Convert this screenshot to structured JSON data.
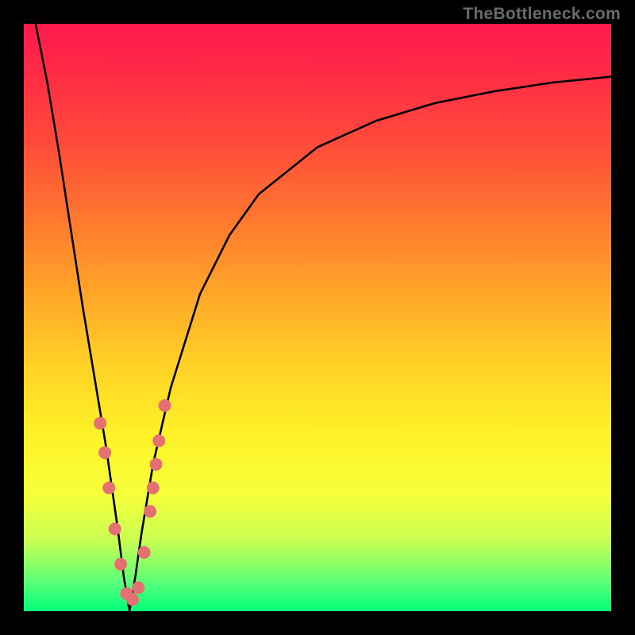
{
  "watermark": {
    "text": "TheBottleneck.com"
  },
  "colors": {
    "frame": "#000000",
    "curve": "#000000",
    "markers": "#e47072",
    "gradient_stops": [
      "#ff1a4d",
      "#ff2a46",
      "#ff4a3a",
      "#ff7a2e",
      "#ffa628",
      "#ffd126",
      "#fff228",
      "#f7ff3a",
      "#c9ff52",
      "#5cff78",
      "#00ff7a"
    ]
  },
  "chart_data": {
    "type": "line",
    "title": "",
    "xlabel": "",
    "ylabel": "",
    "xlim": [
      0,
      100
    ],
    "ylim": [
      0,
      100
    ],
    "notch_x": 18,
    "series": [
      {
        "name": "bottleneck-curve",
        "x": [
          2,
          4,
          6,
          8,
          10,
          12,
          14,
          16,
          17,
          18,
          19,
          20,
          22,
          25,
          30,
          35,
          40,
          50,
          60,
          70,
          80,
          90,
          100
        ],
        "y": [
          100,
          90,
          78,
          65,
          52,
          40,
          28,
          14,
          6,
          0,
          6,
          13,
          25,
          38,
          54,
          64,
          71,
          79,
          83.5,
          86.5,
          88.5,
          90,
          91
        ]
      }
    ],
    "markers": {
      "name": "highlighted-points",
      "x": [
        13.0,
        13.8,
        14.5,
        15.5,
        16.5,
        17.5,
        18.5,
        19.5,
        20.5,
        21.5,
        22.0,
        22.5,
        23.0,
        24.0
      ],
      "y": [
        32,
        27,
        21,
        14,
        8,
        3,
        2,
        4,
        10,
        17,
        21,
        25,
        29,
        35
      ]
    }
  }
}
